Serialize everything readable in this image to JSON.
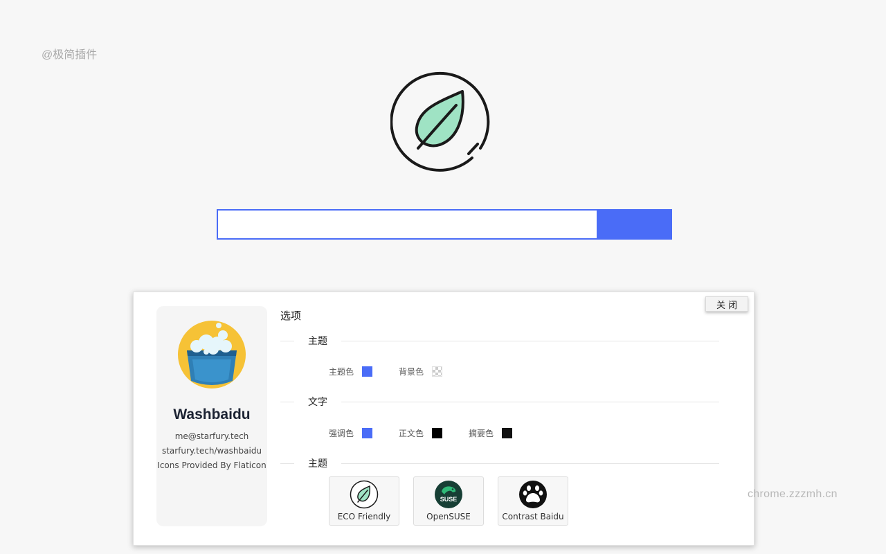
{
  "watermarks": {
    "top_left": "@极简插件",
    "bottom_right": "chrome.zzzmh.cn"
  },
  "logo": {
    "icon": "leaf-icon",
    "leaf_color": "#9fe3c4"
  },
  "search": {
    "value": "",
    "placeholder": "",
    "button_label": "",
    "accent": "#4a6cf7"
  },
  "panel": {
    "close_label": "关闭",
    "profile": {
      "avatar_icon": "bucket-icon",
      "name": "Washbaidu",
      "email": "me@starfury.tech",
      "url": "starfury.tech/washbaidu",
      "credit": "Icons Provided By Flaticon"
    },
    "options_title": "选项",
    "sections": {
      "theme_colors": {
        "title": "主题",
        "items": [
          {
            "label": "主题色",
            "color": "#4a6cf7"
          },
          {
            "label": "背景色",
            "color": "transparent"
          }
        ]
      },
      "text_colors": {
        "title": "文字",
        "items": [
          {
            "label": "强调色",
            "color": "#4a6cf7"
          },
          {
            "label": "正文色",
            "color": "#000000"
          },
          {
            "label": "摘要色",
            "color": "#111111"
          }
        ]
      },
      "themes": {
        "title": "主题",
        "items": [
          {
            "label": "ECO Friendly",
            "icon": "leaf-icon"
          },
          {
            "label": "OpenSUSE",
            "icon": "suse-chameleon-icon",
            "icon_text": "SUSE"
          },
          {
            "label": "Contrast Baidu",
            "icon": "paw-icon"
          }
        ]
      }
    }
  }
}
